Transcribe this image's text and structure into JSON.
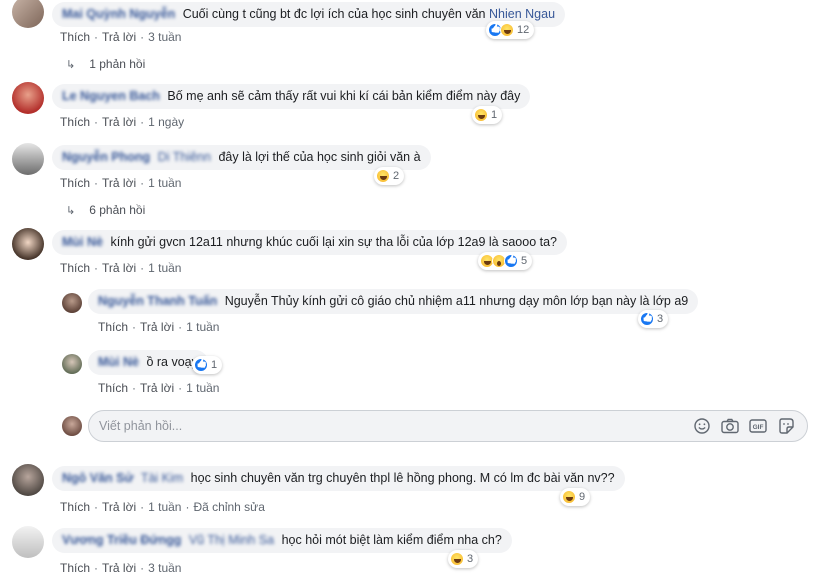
{
  "comments": [
    {
      "author": "Mai Quỳnh Nguyễn",
      "text": "Cuối cùng t cũng bt đc lợi ích của học sinh chuyên văn",
      "mention": "Nhien Ngau",
      "actions": [
        "Thích",
        "Trả lời",
        "3 tuần"
      ],
      "reactions": {
        "icons": [
          "like",
          "haha"
        ],
        "count": "12"
      },
      "replies_link": "1 phản hồi"
    },
    {
      "author": "Le Nguyen Bach",
      "text": "Bố mẹ anh sẽ cảm thấy rất vui khi kí cái bản kiểm điểm này đây",
      "actions": [
        "Thích",
        "Trả lời",
        "1 ngày"
      ],
      "reactions": {
        "icons": [
          "haha"
        ],
        "count": "1"
      }
    },
    {
      "author": "Nguyễn Phong",
      "tag": "Di Thiênn",
      "text": "đây là lợi thế của học sinh giỏi văn à",
      "actions": [
        "Thích",
        "Trả lời",
        "1 tuần"
      ],
      "reactions": {
        "icons": [
          "haha"
        ],
        "count": "2"
      },
      "replies_link": "6 phản hồi"
    },
    {
      "author": "Mùi Nè",
      "text": "kính gửi gvcn 12a11 nhưng khúc cuối lại xin sự tha lỗi của lớp 12a9 là saooo ta?",
      "actions": [
        "Thích",
        "Trả lời",
        "1 tuần"
      ],
      "reactions": {
        "icons": [
          "haha",
          "wow",
          "like"
        ],
        "count": "5"
      }
    },
    {
      "author": "Nguyễn Thanh Tuấn",
      "text": "Nguyễn Thủy kính gửi cô giáo chủ nhiệm a11 nhưng dạy môn lớp bạn này là lớp a9",
      "actions": [
        "Thích",
        "Trả lời",
        "1 tuần"
      ],
      "reactions": {
        "icons": [
          "like"
        ],
        "count": "3"
      }
    },
    {
      "author": "Mùi Nè",
      "text": "ồ ra voạy",
      "actions": [
        "Thích",
        "Trả lời",
        "1 tuần"
      ],
      "reactions": {
        "icons": [
          "like"
        ],
        "count": "1"
      }
    },
    {
      "author": "Ngô Văn Sử",
      "tag": "Tài Kim",
      "text": "học sinh chuyên văn trg chuyên thpl lê hồng phong. M có lm đc bài văn nv??",
      "actions": [
        "Thích",
        "Trả lời",
        "1 tuần",
        "Đã chỉnh sửa"
      ],
      "reactions": {
        "icons": [
          "haha"
        ],
        "count": "9"
      }
    },
    {
      "author": "Vương Triều Đứngg",
      "tag": "Vũ Thị Minh Sa",
      "text": "học hỏi mót biệt làm kiểm điểm nha ch?",
      "actions": [
        "Thích",
        "Trả lời",
        "3 tuần"
      ],
      "reactions": {
        "icons": [
          "haha"
        ],
        "count": "3"
      }
    }
  ],
  "reply_box": {
    "placeholder": "Viết phản hồi..."
  },
  "colors": {
    "link": "#385898",
    "bubble": "#f2f3f5",
    "meta": "#606770",
    "like_blue": "#1877f2",
    "haha_yellow": "#f7b125"
  }
}
